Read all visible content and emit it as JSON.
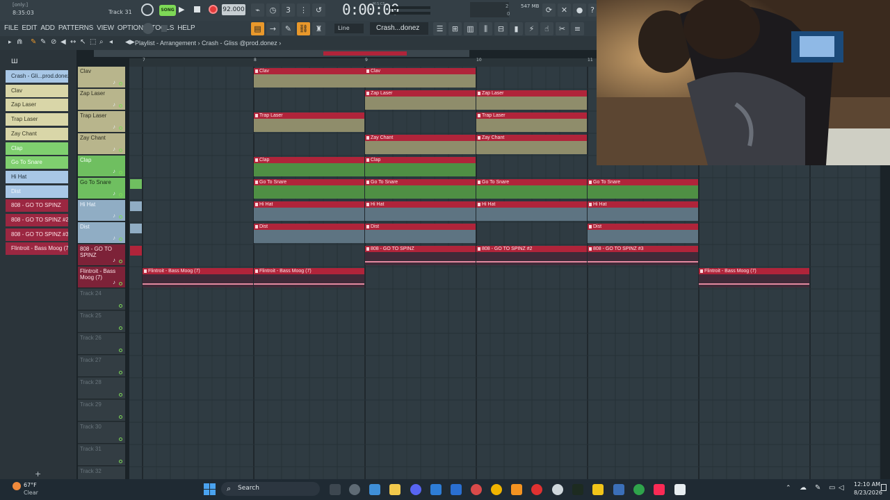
{
  "app": {
    "hint_title": "[only:]",
    "time_display": "8:35:03",
    "track_hint": "Track 31",
    "song_mode": "SONG",
    "tempo": "92.000",
    "main_clock": "0:00:00",
    "clock_small": "M:S:CS",
    "cpu_label": "547 MB",
    "cpu_small_1": "2",
    "cpu_small_2": "0",
    "menu": [
      "FILE",
      "EDIT",
      "ADD",
      "PATTERNS",
      "VIEW",
      "OPTIONS",
      "TOOLS",
      "HELP"
    ],
    "snap_label": "Line",
    "pattern_label": "Crash...donez"
  },
  "playlist": {
    "breadcrumb": "Playlist - Arrangement › Crash - Gliss @prod.donez ›",
    "ruler": [
      "7",
      "8",
      "9",
      "10",
      "11"
    ]
  },
  "browser": {
    "items": [
      {
        "label": "Crash - Gli...prod.donez",
        "color": "#a8c7e6",
        "text": "#1d2b36"
      },
      {
        "label": "Clav",
        "color": "#d9d6a8",
        "text": "#3a3a26"
      },
      {
        "label": "Zap Laser",
        "color": "#d9d6a8",
        "text": "#3a3a26"
      },
      {
        "label": "Trap Laser",
        "color": "#d9d6a8",
        "text": "#3a3a26"
      },
      {
        "label": "Zay Chant",
        "color": "#d9d6a8",
        "text": "#3a3a26"
      },
      {
        "label": "Clap",
        "color": "#7fcf6f",
        "text": "#f2fff0"
      },
      {
        "label": "Go To Snare",
        "color": "#7fcf6f",
        "text": "#f2fff0"
      },
      {
        "label": "Hi Hat",
        "color": "#a8c7e6",
        "text": "#1d2b36"
      },
      {
        "label": "Dist",
        "color": "#a8c7e6",
        "text": "#f2f8ff"
      },
      {
        "label": "808 - GO TO SPINZ",
        "color": "#9b2741",
        "text": "#ffe3e8"
      },
      {
        "label": "808 - GO TO SPINZ #2",
        "color": "#9b2741",
        "text": "#ffe3e8"
      },
      {
        "label": "808 - GO TO SPINZ #3",
        "color": "#9b2741",
        "text": "#ffe3e8"
      },
      {
        "label": "Flintroit - Bass Moog (7)",
        "color": "#9b2741",
        "text": "#ffe3e8"
      }
    ]
  },
  "tracks": [
    {
      "label": "Clav",
      "color": "#b8b58c",
      "text": "#2f2f22"
    },
    {
      "label": "Zap Laser",
      "color": "#b8b58c",
      "text": "#2f2f22"
    },
    {
      "label": "Trap Laser",
      "color": "#b8b58c",
      "text": "#2f2f22"
    },
    {
      "label": "Zay Chant",
      "color": "#b8b58c",
      "text": "#2f2f22"
    },
    {
      "label": "Clap",
      "color": "#6fbf60",
      "text": "#effff0"
    },
    {
      "label": "Go To Snare",
      "color": "#6fbf60",
      "text": "#1c2e18"
    },
    {
      "label": "Hi Hat",
      "color": "#90adc4",
      "text": "#f2f8ff"
    },
    {
      "label": "Dist",
      "color": "#90adc4",
      "text": "#f2f8ff"
    },
    {
      "label": "808 - GO TO SPINZ",
      "color": "#7d2238",
      "text": "#ffe3e8"
    },
    {
      "label": "Flintroit - Bass Moog (7)",
      "color": "#7d2238",
      "text": "#ffe3e8"
    },
    {
      "label": "Track 24",
      "color": "#333d43",
      "text": "#69757c"
    },
    {
      "label": "Track 25",
      "color": "#333d43",
      "text": "#69757c"
    },
    {
      "label": "Track 26",
      "color": "#333d43",
      "text": "#69757c"
    },
    {
      "label": "Track 27",
      "color": "#333d43",
      "text": "#69757c"
    },
    {
      "label": "Track 28",
      "color": "#333d43",
      "text": "#69757c"
    },
    {
      "label": "Track 29",
      "color": "#333d43",
      "text": "#69757c"
    },
    {
      "label": "Track 30",
      "color": "#333d43",
      "text": "#69757c"
    },
    {
      "label": "Track 31",
      "color": "#333d43",
      "text": "#69757c"
    },
    {
      "label": "Track 32",
      "color": "#333d43",
      "text": "#69757c"
    }
  ],
  "clips": [
    {
      "label": "Clav",
      "bar": 8,
      "len": 2,
      "track": 0,
      "body": "#8f8d6b"
    },
    {
      "label": "Clav",
      "bar": 9,
      "len": 1,
      "track": 0,
      "body": "#8f8d6b"
    },
    {
      "label": "Zap Laser",
      "bar": 9,
      "len": 1,
      "track": 1,
      "body": "#8f8d6b"
    },
    {
      "label": "Zap Laser",
      "bar": 10,
      "len": 1,
      "track": 1,
      "body": "#8f8d6b"
    },
    {
      "label": "Trap Laser",
      "bar": 8,
      "len": 1,
      "track": 2,
      "body": "#8f8d6b"
    },
    {
      "label": "Trap Laser",
      "bar": 10,
      "len": 1,
      "track": 2,
      "body": "#8f8d6b"
    },
    {
      "label": "Zay Chant",
      "bar": 9,
      "len": 1,
      "track": 3,
      "body": "#8f8d6b"
    },
    {
      "label": "Zay Chant",
      "bar": 10,
      "len": 1,
      "track": 3,
      "body": "#8f8d6b"
    },
    {
      "label": "Clap",
      "bar": 8,
      "len": 1,
      "track": 4,
      "body": "#4f8f44"
    },
    {
      "label": "Clap",
      "bar": 9,
      "len": 1,
      "track": 4,
      "body": "#4f8f44"
    },
    {
      "label": "Go To Snare",
      "bar": 8,
      "len": 1,
      "track": 5,
      "body": "#4f8f44"
    },
    {
      "label": "Go To Snare",
      "bar": 9,
      "len": 1,
      "track": 5,
      "body": "#4f8f44"
    },
    {
      "label": "Go To Snare",
      "bar": 10,
      "len": 1,
      "track": 5,
      "body": "#4f8f44"
    },
    {
      "label": "Go To Snare",
      "bar": 11,
      "len": 1,
      "track": 5,
      "body": "#4f8f44"
    },
    {
      "label": "Hi Hat",
      "bar": 8,
      "len": 1,
      "track": 6,
      "body": "#5e7482"
    },
    {
      "label": "Hi Hat",
      "bar": 9,
      "len": 1,
      "track": 6,
      "body": "#5e7482"
    },
    {
      "label": "Hi Hat",
      "bar": 10,
      "len": 1,
      "track": 6,
      "body": "#5e7482"
    },
    {
      "label": "Hi Hat",
      "bar": 11,
      "len": 1,
      "track": 6,
      "body": "#5e7482"
    },
    {
      "label": "Dist",
      "bar": 8,
      "len": 1,
      "track": 7,
      "body": "#5e7482"
    },
    {
      "label": "Dist",
      "bar": 9,
      "len": 1,
      "track": 7,
      "body": "#5e7482"
    },
    {
      "label": "Dist",
      "bar": 11,
      "len": 1,
      "track": 7,
      "body": "#5e7482"
    },
    {
      "label": "808 - GO TO SPINZ",
      "bar": 9,
      "len": 1,
      "track": 8,
      "body": "#3f2a38"
    },
    {
      "label": "808 - GO TO SPINZ #2",
      "bar": 10,
      "len": 1,
      "track": 8,
      "body": "#3f2a38"
    },
    {
      "label": "808 - GO TO SPINZ #3",
      "bar": 11,
      "len": 1,
      "track": 8,
      "body": "#3f2a38"
    },
    {
      "label": "Flintroit - Bass Moog (7)",
      "bar": 7,
      "len": 1,
      "track": 9,
      "body": "#3f2a38"
    },
    {
      "label": "Flintroit - Bass Moog (7)",
      "bar": 8,
      "len": 1,
      "track": 9,
      "body": "#3f2a38"
    },
    {
      "label": "Flintroit - Bass Moog (7)",
      "bar": 12,
      "len": 1,
      "track": 9,
      "body": "#3f2a38"
    }
  ],
  "taskbar": {
    "weather_temp": "67°F",
    "weather_desc": "Clear",
    "search_label": "Search",
    "clock_time": "12:10 AM",
    "clock_date": "8/23/2026"
  }
}
